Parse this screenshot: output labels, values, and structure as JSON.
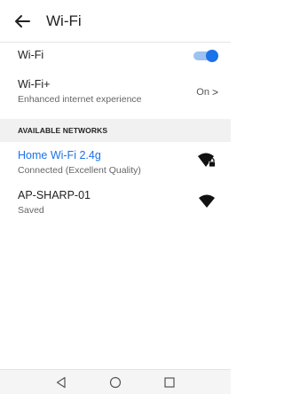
{
  "appbar": {
    "title": "Wi-Fi",
    "back_icon": "back-arrow-icon"
  },
  "settings": {
    "wifi": {
      "label": "Wi-Fi",
      "enabled": true
    },
    "wifi_plus": {
      "label": "Wi-Fi+",
      "description": "Enhanced internet experience",
      "value": "On",
      "chevron": ">"
    }
  },
  "available_networks": {
    "header": "AVAILABLE NETWORKS",
    "items": [
      {
        "ssid": "Home Wi-Fi 2.4g",
        "status": "Connected (Excellent Quality)",
        "secured": true,
        "icon": "wifi-locked-icon"
      },
      {
        "ssid": "AP-SHARP-01",
        "status": "Saved",
        "secured": false,
        "icon": "wifi-icon"
      }
    ]
  },
  "navbar": {
    "icons": [
      "back-triangle-icon",
      "home-circle-icon",
      "recents-square-icon"
    ]
  },
  "colors": {
    "accent": "#1a73e8",
    "toggle_track": "#9cc2f0",
    "section_bg": "#f1f1f1"
  }
}
